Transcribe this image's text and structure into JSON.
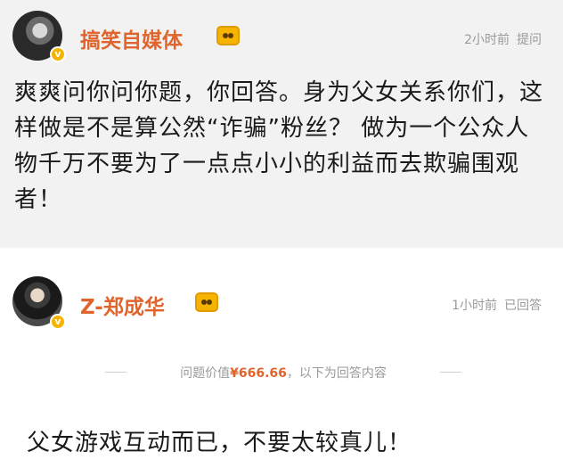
{
  "question": {
    "username": "搞笑自媒体",
    "time": "2小时前",
    "action": "提问",
    "text": "爽爽问你问你题，你回答。身为父女关系你们，这样做是不是算公然“诈骗”粉丝？ 做为一个公众人物千万不要为了一点点小小的利益而去欺骗围观者！"
  },
  "answer": {
    "username": "Z-郑成华",
    "time": "1小时前",
    "action": "已回答",
    "value_prefix": "问题价值",
    "value_amount": "¥666.66",
    "value_suffix": "，以下为回答内容",
    "text": "父女游戏互动而已，不要太较真儿！"
  },
  "colors": {
    "username": "#e0642b",
    "price": "#e0642b",
    "meta": "#9a9a9a",
    "question_bg": "#f2f2f2",
    "badge": "#f6b400"
  },
  "icons": {
    "verified_badge": "verified-v-icon",
    "member_crown": "vip-crown-icon"
  }
}
